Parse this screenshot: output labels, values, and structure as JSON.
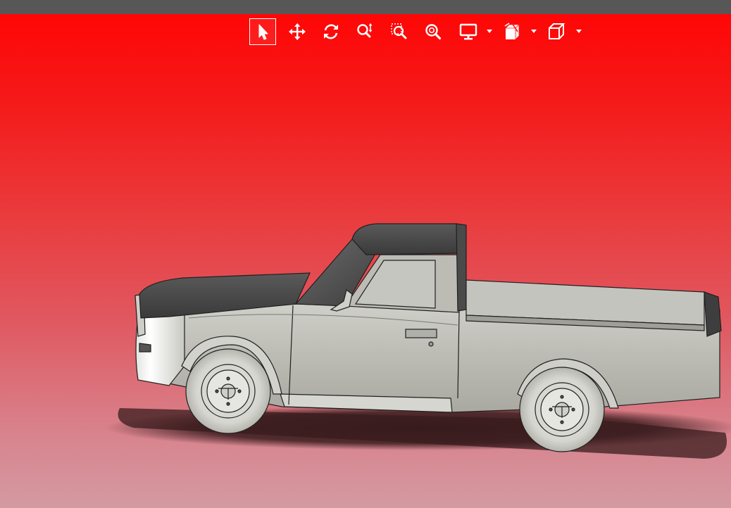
{
  "app": {
    "title_bar": {
      "text": ""
    }
  },
  "toolbar": {
    "tools": [
      {
        "id": "select",
        "icon": "select-cursor-icon",
        "active": true
      },
      {
        "id": "pan",
        "icon": "pan-move-icon",
        "active": false
      },
      {
        "id": "rotate",
        "icon": "rotate-icon",
        "active": false
      },
      {
        "id": "zoom",
        "icon": "zoom-icon",
        "active": false
      },
      {
        "id": "zoom-window",
        "icon": "zoom-window-icon",
        "active": false
      },
      {
        "id": "zoom-fit",
        "icon": "zoom-fit-icon",
        "active": false
      },
      {
        "id": "display",
        "icon": "display-monitor-icon",
        "has_dropdown": true
      },
      {
        "id": "section",
        "icon": "section-view-icon",
        "has_dropdown": true
      },
      {
        "id": "view-orientation",
        "icon": "view-cube-icon",
        "has_dropdown": true
      }
    ]
  },
  "viewport": {
    "background_top": "#ff0606",
    "background_bottom": "#d49aa2",
    "model": {
      "name": "pickup-truck-model",
      "body_color": "#c2c2bc",
      "roof_color": "#4a4a4a"
    }
  }
}
